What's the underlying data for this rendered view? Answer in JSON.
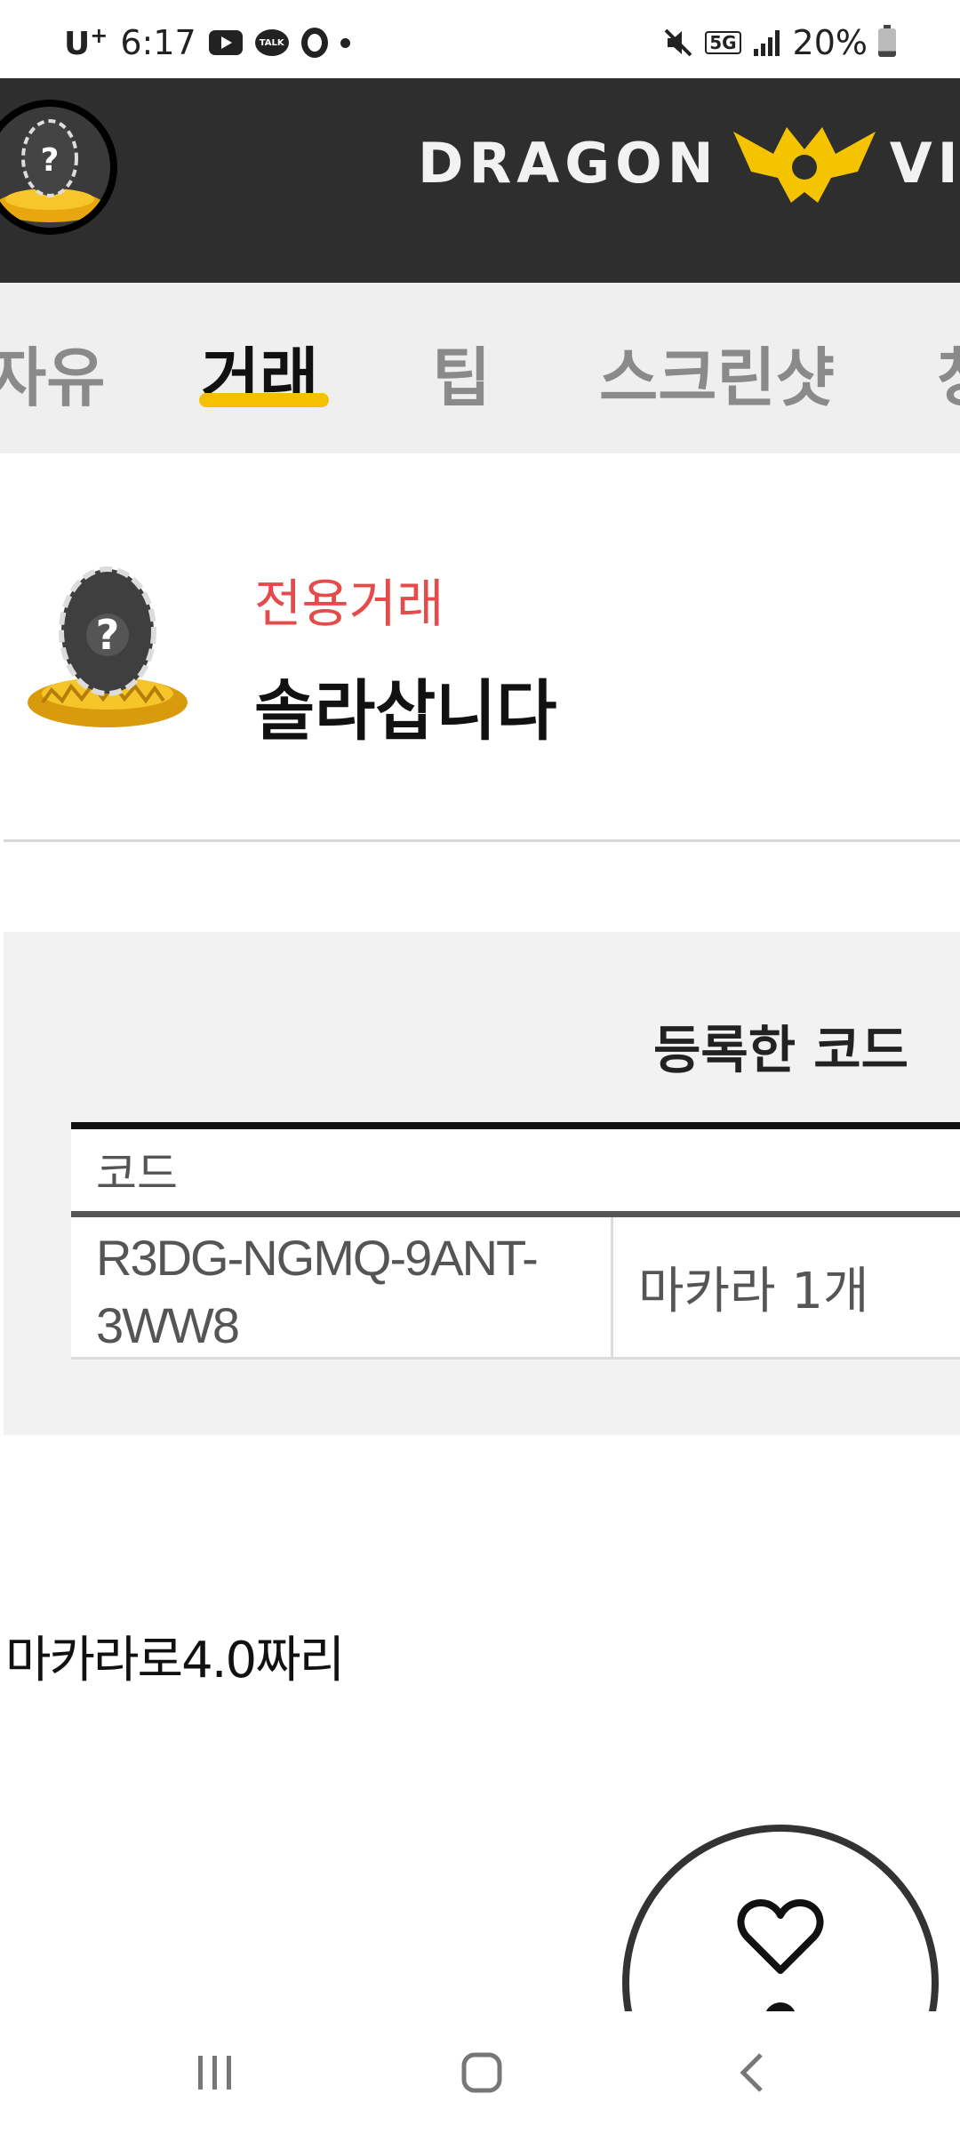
{
  "status_bar": {
    "carrier": "U",
    "carrier_sup": "+",
    "time": "6:17",
    "talk_badge": "TALK",
    "network": "5G",
    "battery": "20%"
  },
  "header": {
    "logo_left": "DRAGON",
    "logo_right": "VIL"
  },
  "tabs": [
    {
      "label": "자유",
      "active": false
    },
    {
      "label": "거래",
      "active": true
    },
    {
      "label": "팁",
      "active": false
    },
    {
      "label": "스크린샷",
      "active": false
    },
    {
      "label": "창",
      "active": false
    }
  ],
  "post": {
    "category": "전용거래",
    "title": "솔라삽니다",
    "body": "마카라로4.0짜리"
  },
  "code_section": {
    "title": "등록한 코드",
    "column_header": "코드",
    "rows": [
      {
        "code": "R3DG-NGMQ-9ANT-3WW8",
        "reward": "마카라 1개"
      }
    ]
  },
  "colors": {
    "header_bg": "#2e2e2e",
    "tab_active_underline": "#f5c000",
    "category_red": "#e64b4b",
    "logo_yellow": "#f5c400"
  },
  "icons": [
    "youtube-icon",
    "kakaotalk-icon",
    "opera-icon",
    "mute-icon",
    "signal-icon",
    "battery-icon",
    "heart-icon",
    "recents-icon",
    "home-icon",
    "back-icon"
  ]
}
